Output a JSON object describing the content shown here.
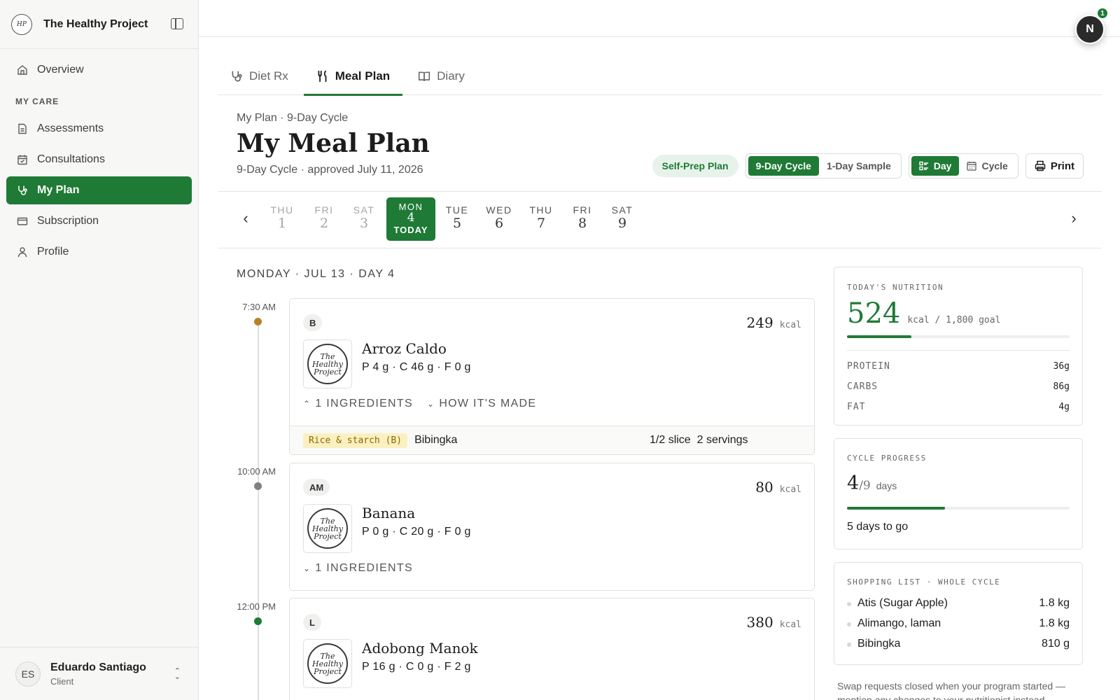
{
  "brand": {
    "name": "The Healthy Project",
    "logo_text": "Healthy Project"
  },
  "sidebar": {
    "items_top": [
      {
        "label": "Overview",
        "icon": "home-icon"
      }
    ],
    "section_label": "MY CARE",
    "items": [
      {
        "label": "Assessments",
        "icon": "document-icon"
      },
      {
        "label": "Consultations",
        "icon": "calendar-icon"
      },
      {
        "label": "My Plan",
        "icon": "stethoscope-icon",
        "active": true
      },
      {
        "label": "Subscription",
        "icon": "card-icon"
      },
      {
        "label": "Profile",
        "icon": "user-icon"
      }
    ],
    "user": {
      "initials": "ES",
      "name": "Eduardo Santiago",
      "role": "Client"
    }
  },
  "topbar": {
    "avatar_initial": "N",
    "notification_count": "1"
  },
  "tabs": [
    {
      "label": "Diet Rx",
      "icon": "stethoscope-icon"
    },
    {
      "label": "Meal Plan",
      "icon": "utensils-icon",
      "active": true
    },
    {
      "label": "Diary",
      "icon": "book-icon"
    }
  ],
  "header": {
    "breadcrumb": "My Plan · 9-Day Cycle",
    "title": "My Meal Plan",
    "subtitle": "9-Day Cycle · approved July 11, 2026",
    "plan_badge": "Self-Prep Plan",
    "cycle_toggle": {
      "options": [
        "9-Day Cycle",
        "1-Day Sample"
      ],
      "selected": "9-Day Cycle"
    },
    "view_toggle": {
      "options": [
        "Day",
        "Cycle"
      ],
      "selected": "Day"
    },
    "print_label": "Print"
  },
  "days": [
    {
      "name": "THU",
      "num": "1",
      "state": "past"
    },
    {
      "name": "FRI",
      "num": "2",
      "state": "past"
    },
    {
      "name": "SAT",
      "num": "3",
      "state": "past"
    },
    {
      "name": "MON",
      "num": "4",
      "state": "today",
      "today_label": "TODAY"
    },
    {
      "name": "TUE",
      "num": "5",
      "state": "future"
    },
    {
      "name": "WED",
      "num": "6",
      "state": "future"
    },
    {
      "name": "THU",
      "num": "7",
      "state": "future"
    },
    {
      "name": "FRI",
      "num": "8",
      "state": "future"
    },
    {
      "name": "SAT",
      "num": "9",
      "state": "future"
    }
  ],
  "day_heading": "MONDAY · JUL 13 · DAY 4",
  "meals": [
    {
      "time": "7:30 AM",
      "dot_color": "#b8802a",
      "tag": "B",
      "kcal": "249",
      "kcal_unit": "kcal",
      "name": "Arroz Caldo",
      "macros": "P 4 g · C 46 g · F 0 g",
      "ingredients_label": "1 INGREDIENTS",
      "ingredients_expanded": true,
      "how_label": "HOW IT'S MADE",
      "ingredient": {
        "category": "Rice & starch (B)",
        "name": "Bibingka",
        "qty": "1/2 slice",
        "servings": "2 servings"
      }
    },
    {
      "time": "10:00 AM",
      "dot_color": "#808080",
      "tag": "AM",
      "kcal": "80",
      "kcal_unit": "kcal",
      "name": "Banana",
      "macros": "P 0 g · C 20 g · F 0 g",
      "ingredients_label": "1 INGREDIENTS",
      "ingredients_expanded": false
    },
    {
      "time": "12:00 PM",
      "dot_color": "#1f7a36",
      "tag": "L",
      "kcal": "380",
      "kcal_unit": "kcal",
      "name": "Adobong Manok",
      "macros": "P 16 g · C 0 g · F 2 g"
    }
  ],
  "nutrition": {
    "label": "TODAY'S NUTRITION",
    "kcal": "524",
    "goal_text": "kcal / 1,800 goal",
    "progress": 0.29,
    "rows": [
      {
        "label": "PROTEIN",
        "value": "36g"
      },
      {
        "label": "CARBS",
        "value": "86g"
      },
      {
        "label": "FAT",
        "value": "4g"
      }
    ]
  },
  "cycle": {
    "label": "CYCLE PROGRESS",
    "current": "4",
    "total": "/9",
    "unit": "days",
    "progress": 0.44,
    "remaining": "5 days to go"
  },
  "shopping": {
    "label": "SHOPPING LIST · WHOLE CYCLE",
    "items": [
      {
        "name": "Atis (Sugar Apple)",
        "qty": "1.8 kg"
      },
      {
        "name": "Alimango, laman",
        "qty": "1.8 kg"
      },
      {
        "name": "Bibingka",
        "qty": "810 g"
      }
    ]
  },
  "swap_note": "Swap requests closed when your program started — mention any changes to your nutritionist instead."
}
